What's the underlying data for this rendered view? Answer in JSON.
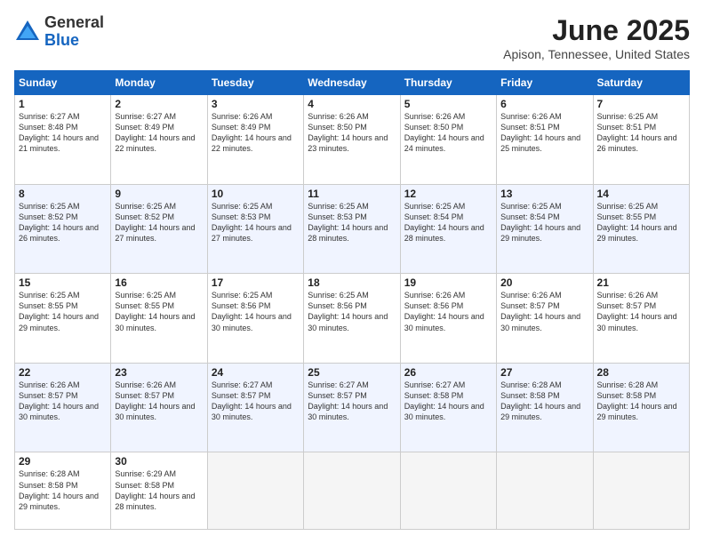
{
  "logo": {
    "general": "General",
    "blue": "Blue"
  },
  "title": {
    "month": "June 2025",
    "location": "Apison, Tennessee, United States"
  },
  "header_days": [
    "Sunday",
    "Monday",
    "Tuesday",
    "Wednesday",
    "Thursday",
    "Friday",
    "Saturday"
  ],
  "weeks": [
    [
      {
        "day": "1",
        "sunrise": "6:27 AM",
        "sunset": "8:48 PM",
        "daylight": "14 hours and 21 minutes."
      },
      {
        "day": "2",
        "sunrise": "6:27 AM",
        "sunset": "8:49 PM",
        "daylight": "14 hours and 22 minutes."
      },
      {
        "day": "3",
        "sunrise": "6:26 AM",
        "sunset": "8:49 PM",
        "daylight": "14 hours and 22 minutes."
      },
      {
        "day": "4",
        "sunrise": "6:26 AM",
        "sunset": "8:50 PM",
        "daylight": "14 hours and 23 minutes."
      },
      {
        "day": "5",
        "sunrise": "6:26 AM",
        "sunset": "8:50 PM",
        "daylight": "14 hours and 24 minutes."
      },
      {
        "day": "6",
        "sunrise": "6:26 AM",
        "sunset": "8:51 PM",
        "daylight": "14 hours and 25 minutes."
      },
      {
        "day": "7",
        "sunrise": "6:25 AM",
        "sunset": "8:51 PM",
        "daylight": "14 hours and 26 minutes."
      }
    ],
    [
      {
        "day": "8",
        "sunrise": "6:25 AM",
        "sunset": "8:52 PM",
        "daylight": "14 hours and 26 minutes."
      },
      {
        "day": "9",
        "sunrise": "6:25 AM",
        "sunset": "8:52 PM",
        "daylight": "14 hours and 27 minutes."
      },
      {
        "day": "10",
        "sunrise": "6:25 AM",
        "sunset": "8:53 PM",
        "daylight": "14 hours and 27 minutes."
      },
      {
        "day": "11",
        "sunrise": "6:25 AM",
        "sunset": "8:53 PM",
        "daylight": "14 hours and 28 minutes."
      },
      {
        "day": "12",
        "sunrise": "6:25 AM",
        "sunset": "8:54 PM",
        "daylight": "14 hours and 28 minutes."
      },
      {
        "day": "13",
        "sunrise": "6:25 AM",
        "sunset": "8:54 PM",
        "daylight": "14 hours and 29 minutes."
      },
      {
        "day": "14",
        "sunrise": "6:25 AM",
        "sunset": "8:55 PM",
        "daylight": "14 hours and 29 minutes."
      }
    ],
    [
      {
        "day": "15",
        "sunrise": "6:25 AM",
        "sunset": "8:55 PM",
        "daylight": "14 hours and 29 minutes."
      },
      {
        "day": "16",
        "sunrise": "6:25 AM",
        "sunset": "8:55 PM",
        "daylight": "14 hours and 30 minutes."
      },
      {
        "day": "17",
        "sunrise": "6:25 AM",
        "sunset": "8:56 PM",
        "daylight": "14 hours and 30 minutes."
      },
      {
        "day": "18",
        "sunrise": "6:25 AM",
        "sunset": "8:56 PM",
        "daylight": "14 hours and 30 minutes."
      },
      {
        "day": "19",
        "sunrise": "6:26 AM",
        "sunset": "8:56 PM",
        "daylight": "14 hours and 30 minutes."
      },
      {
        "day": "20",
        "sunrise": "6:26 AM",
        "sunset": "8:57 PM",
        "daylight": "14 hours and 30 minutes."
      },
      {
        "day": "21",
        "sunrise": "6:26 AM",
        "sunset": "8:57 PM",
        "daylight": "14 hours and 30 minutes."
      }
    ],
    [
      {
        "day": "22",
        "sunrise": "6:26 AM",
        "sunset": "8:57 PM",
        "daylight": "14 hours and 30 minutes."
      },
      {
        "day": "23",
        "sunrise": "6:26 AM",
        "sunset": "8:57 PM",
        "daylight": "14 hours and 30 minutes."
      },
      {
        "day": "24",
        "sunrise": "6:27 AM",
        "sunset": "8:57 PM",
        "daylight": "14 hours and 30 minutes."
      },
      {
        "day": "25",
        "sunrise": "6:27 AM",
        "sunset": "8:57 PM",
        "daylight": "14 hours and 30 minutes."
      },
      {
        "day": "26",
        "sunrise": "6:27 AM",
        "sunset": "8:58 PM",
        "daylight": "14 hours and 30 minutes."
      },
      {
        "day": "27",
        "sunrise": "6:28 AM",
        "sunset": "8:58 PM",
        "daylight": "14 hours and 29 minutes."
      },
      {
        "day": "28",
        "sunrise": "6:28 AM",
        "sunset": "8:58 PM",
        "daylight": "14 hours and 29 minutes."
      }
    ],
    [
      {
        "day": "29",
        "sunrise": "6:28 AM",
        "sunset": "8:58 PM",
        "daylight": "14 hours and 29 minutes."
      },
      {
        "day": "30",
        "sunrise": "6:29 AM",
        "sunset": "8:58 PM",
        "daylight": "14 hours and 28 minutes."
      },
      null,
      null,
      null,
      null,
      null
    ]
  ]
}
